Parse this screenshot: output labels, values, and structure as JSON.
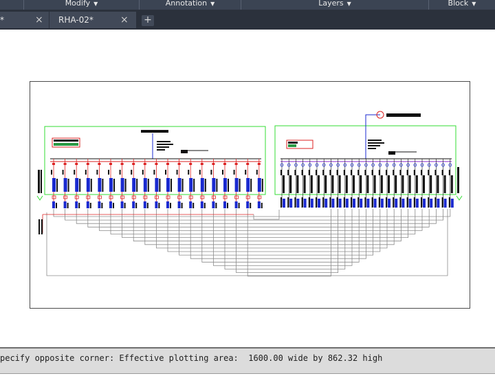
{
  "ribbon": {
    "panels": [
      {
        "label": "Modify"
      },
      {
        "label": "Annotation"
      },
      {
        "label": "Layers"
      },
      {
        "label": "Block"
      }
    ]
  },
  "tabs": [
    {
      "label": "*"
    },
    {
      "label": "RHA-02*"
    }
  ],
  "icons": {
    "close": "×",
    "plus": "+",
    "caret": "▼"
  },
  "command": {
    "text": "pecify opposite corner: Effective plotting area:  1600.00 wide by 862.32 high"
  },
  "colors": {
    "frame": "#33dd33",
    "red": "#dd2222",
    "blue": "#1a2ad0",
    "black": "#111111",
    "grey": "#8a8a8a"
  }
}
